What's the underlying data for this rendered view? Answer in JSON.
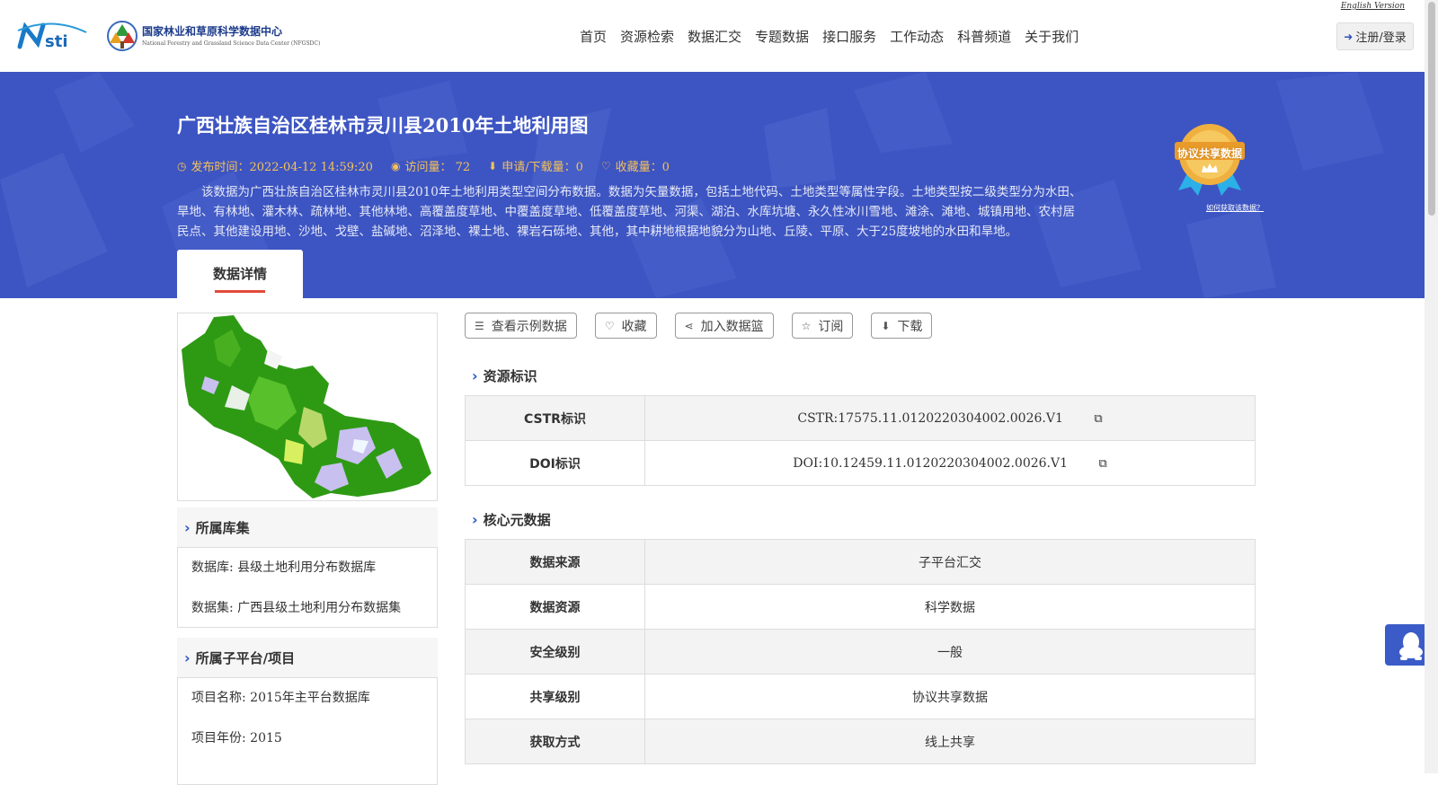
{
  "header": {
    "logo_nsti": "Nsti",
    "logo_cn": "国家林业和草原科学数据中心",
    "logo_en": "National Forestry and Grassland Science Data Center (NFGSDC)",
    "nav": [
      "首页",
      "资源检索",
      "数据汇交",
      "专题数据",
      "接口服务",
      "工作动态",
      "科普频道",
      "关于我们"
    ],
    "english_link": "English Version",
    "login_label": "注册/登录"
  },
  "banner": {
    "title": "广西壮族自治区桂林市灵川县2010年土地利用图",
    "publish_time": "发布时间：2022-04-12 14:59:20",
    "visits": "访问量： 72",
    "downloads": "申请/下载量：0",
    "favorites": "收藏量：0",
    "description": "该数据为广西壮族自治区桂林市灵川县2010年土地利用类型空间分布数据。数据为矢量数据，包括土地代码、土地类型等属性字段。土地类型按二级类型分为水田、旱地、有林地、灌木林、疏林地、其他林地、高覆盖度草地、中覆盖度草地、低覆盖度草地、河渠、湖泊、水库坑塘、永久性冰川雪地、滩涂、滩地、城镇用地、农村居民点、其他建设用地、沙地、戈壁、盐碱地、沼泽地、裸土地、裸岩石砾地、其他，其中耕地根据地貌分为山地、丘陵、平原、大于25度坡地的水田和旱地。",
    "badge_label": "协议共享数据",
    "how_to_link": "如何获取该数据？",
    "tab_label": "数据详情"
  },
  "sidebar": {
    "collection_title": "所属库集",
    "database": "数据库: 县级土地利用分布数据库",
    "dataset": "数据集: 广西县级土地利用分布数据集",
    "platform_title": "所属子平台/项目",
    "project_name": "项目名称: 2015年主平台数据库",
    "project_year": "项目年份: 2015"
  },
  "actions": {
    "sample": "查看示例数据",
    "favorite": "收藏",
    "basket": "加入数据篮",
    "subscribe": "订阅",
    "download": "下载"
  },
  "resource_id": {
    "title": "资源标识",
    "rows": [
      {
        "key": "CSTR标识",
        "value": "CSTR:17575.11.0120220304002.0026.V1"
      },
      {
        "key": "DOI标识",
        "value": "DOI:10.12459.11.0120220304002.0026.V1"
      }
    ]
  },
  "core_meta": {
    "title": "核心元数据",
    "rows": [
      {
        "key": "数据来源",
        "value": "子平台汇交"
      },
      {
        "key": "数据资源",
        "value": "科学数据"
      },
      {
        "key": "安全级别",
        "value": "一般"
      },
      {
        "key": "共享级别",
        "value": "协议共享数据"
      },
      {
        "key": "获取方式",
        "value": "线上共享"
      }
    ]
  },
  "colors": {
    "banner": "#3d55c2",
    "accent_gold": "#f5c15a",
    "tab_underline": "#e04a3a",
    "chevron": "#2b56c8"
  }
}
